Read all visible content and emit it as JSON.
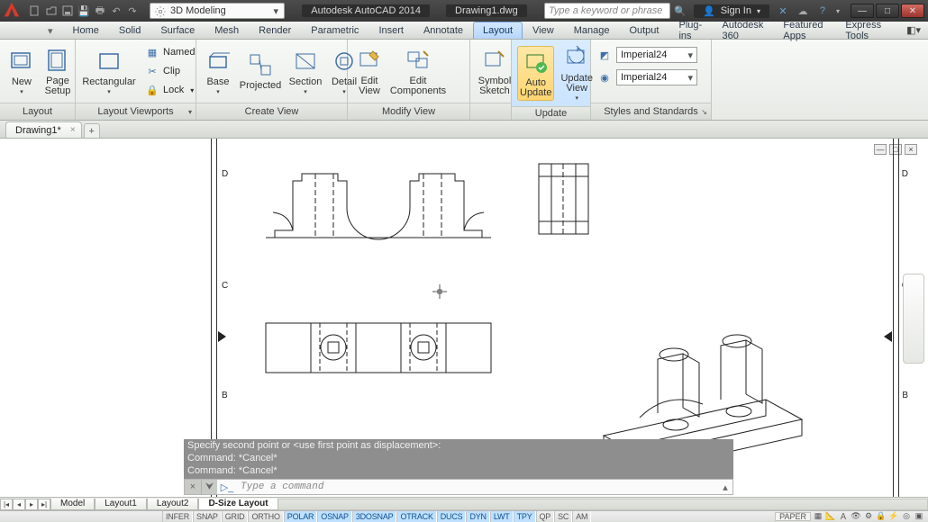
{
  "title": {
    "app": "Autodesk AutoCAD 2014",
    "doc": "Drawing1.dwg"
  },
  "workspace": "3D Modeling",
  "search_placeholder": "Type a keyword or phrase",
  "signin": "Sign In",
  "menu_tabs": [
    "Home",
    "Solid",
    "Surface",
    "Mesh",
    "Render",
    "Parametric",
    "Insert",
    "Annotate",
    "Layout",
    "View",
    "Manage",
    "Output",
    "Plug-ins",
    "Autodesk 360",
    "Featured Apps",
    "Express Tools"
  ],
  "active_menu_tab": "Layout",
  "ribbon": {
    "layout": {
      "label": "Layout",
      "new": "New",
      "page_setup": "Page\nSetup"
    },
    "viewports": {
      "label": "Layout Viewports",
      "rectangular": "Rectangular",
      "named": "Named",
      "clip": "Clip",
      "lock": "Lock"
    },
    "create_view": {
      "label": "Create View",
      "base": "Base",
      "projected": "Projected",
      "section": "Section",
      "detail": "Detail"
    },
    "modify_view": {
      "label": "Modify View",
      "edit_view": "Edit\nView",
      "edit_components": "Edit\nComponents",
      "symbol_sketch": "Symbol\nSketch"
    },
    "update": {
      "label": "Update",
      "auto_update": "Auto\nUpdate",
      "update_view": "Update\nView"
    },
    "styles": {
      "label": "Styles and Standards",
      "opt1": "Imperial24",
      "opt2": "Imperial24",
      "launcher": "↘"
    }
  },
  "doc_tab": "Drawing1*",
  "canvas": {
    "grid_rows": [
      "D",
      "C",
      "B"
    ]
  },
  "console": {
    "lines": [
      "Specify second point or <use first point as displacement>:",
      "Command: *Cancel*",
      "Command: *Cancel*"
    ],
    "placeholder": "Type a command"
  },
  "layout_tabs": [
    "Model",
    "Layout1",
    "Layout2",
    "D-Size Layout"
  ],
  "active_layout_tab": "D-Size Layout",
  "status": {
    "coords": "",
    "buttons": [
      {
        "t": "INFER",
        "on": false
      },
      {
        "t": "SNAP",
        "on": false
      },
      {
        "t": "GRID",
        "on": false
      },
      {
        "t": "ORTHO",
        "on": false
      },
      {
        "t": "POLAR",
        "on": true
      },
      {
        "t": "OSNAP",
        "on": true
      },
      {
        "t": "3DOSNAP",
        "on": true
      },
      {
        "t": "OTRACK",
        "on": true
      },
      {
        "t": "DUCS",
        "on": true
      },
      {
        "t": "DYN",
        "on": true
      },
      {
        "t": "LWT",
        "on": true
      },
      {
        "t": "TPY",
        "on": true
      },
      {
        "t": "QP",
        "on": false
      },
      {
        "t": "SC",
        "on": false
      },
      {
        "t": "AM",
        "on": false
      }
    ],
    "space": "PAPER"
  }
}
